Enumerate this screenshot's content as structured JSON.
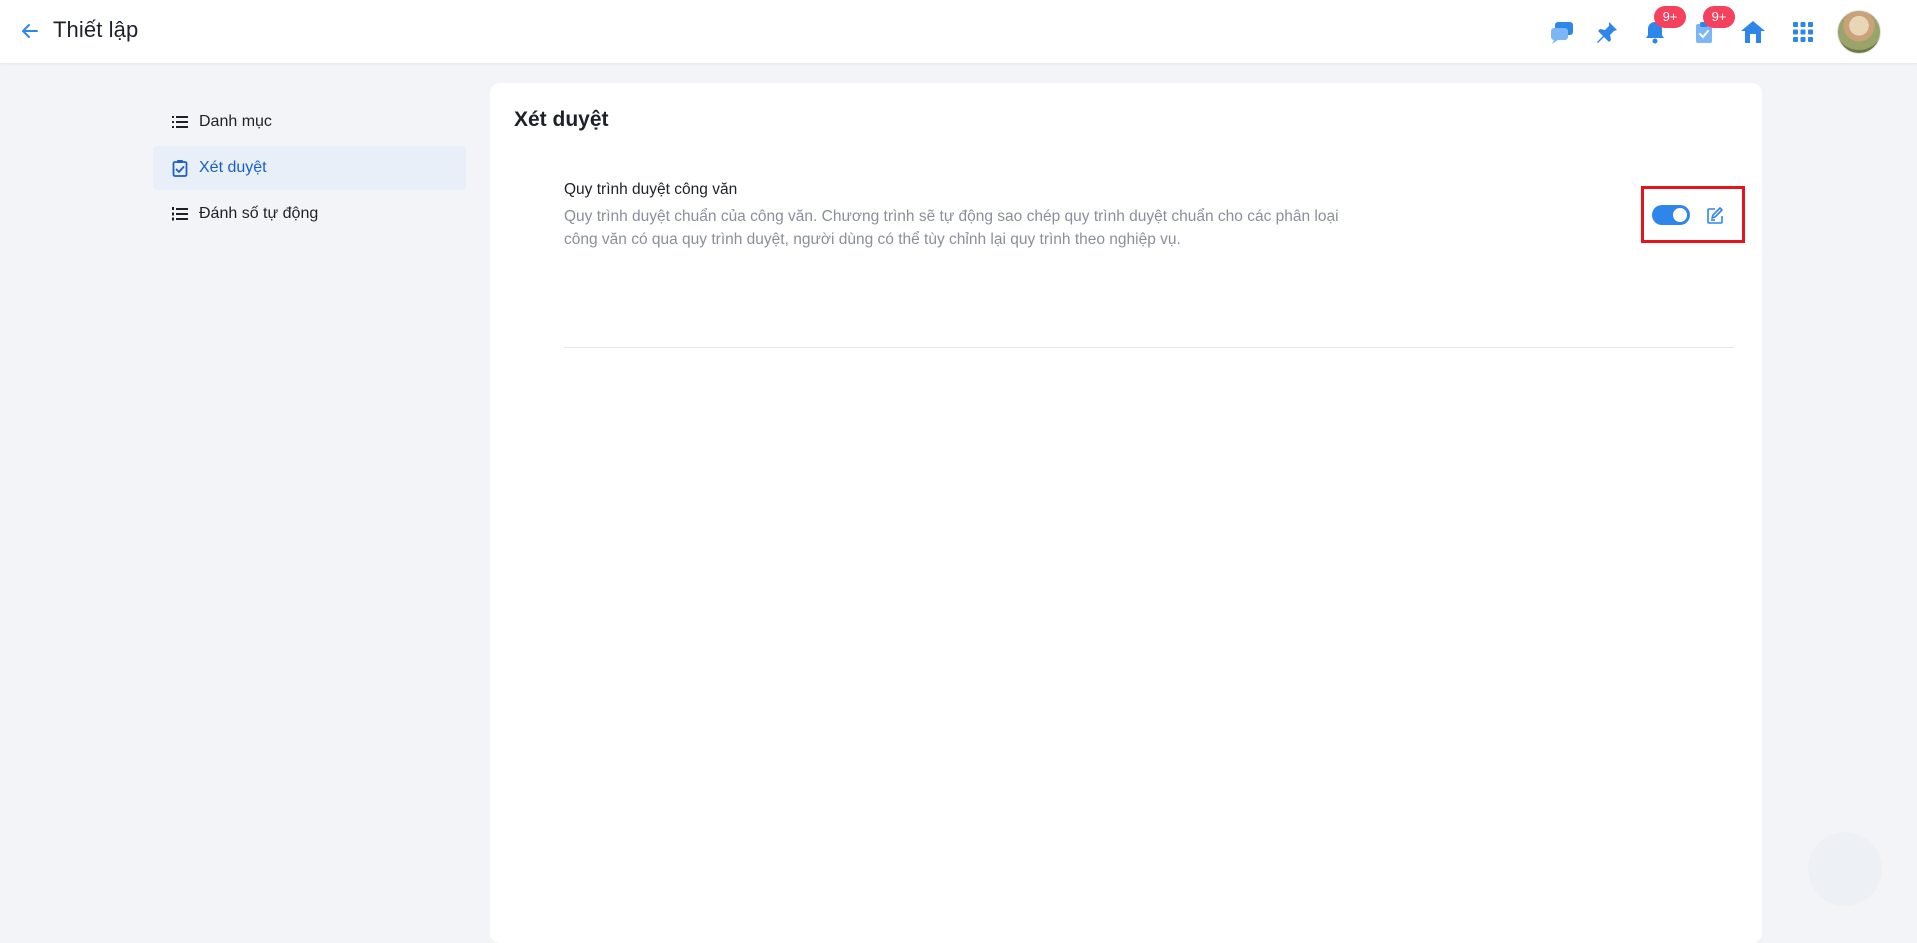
{
  "header": {
    "title": "Thiết lập",
    "notification_badge": "9+",
    "task_badge": "9+"
  },
  "sidebar": {
    "items": [
      {
        "label": "Danh mục",
        "icon": "list-icon",
        "active": false
      },
      {
        "label": "Xét duyệt",
        "icon": "checklist-icon",
        "active": true
      },
      {
        "label": "Đánh số tự động",
        "icon": "numbered-list-icon",
        "active": false
      }
    ]
  },
  "main": {
    "title": "Xét duyệt",
    "setting": {
      "title": "Quy trình duyệt công văn",
      "description": "Quy trình duyệt chuẩn của công văn. Chương trình sẽ tự động sao chép quy trình duyệt chuẩn cho các phân loại công văn có qua quy trình duyệt, người dùng có thể tùy chỉnh lại quy trình theo nghiệp vụ.",
      "enabled": true
    }
  },
  "colors": {
    "accent": "#2f86ea",
    "badge": "#f5405e",
    "highlight_border": "#e8141c",
    "active_item_bg": "#e9eff8"
  }
}
